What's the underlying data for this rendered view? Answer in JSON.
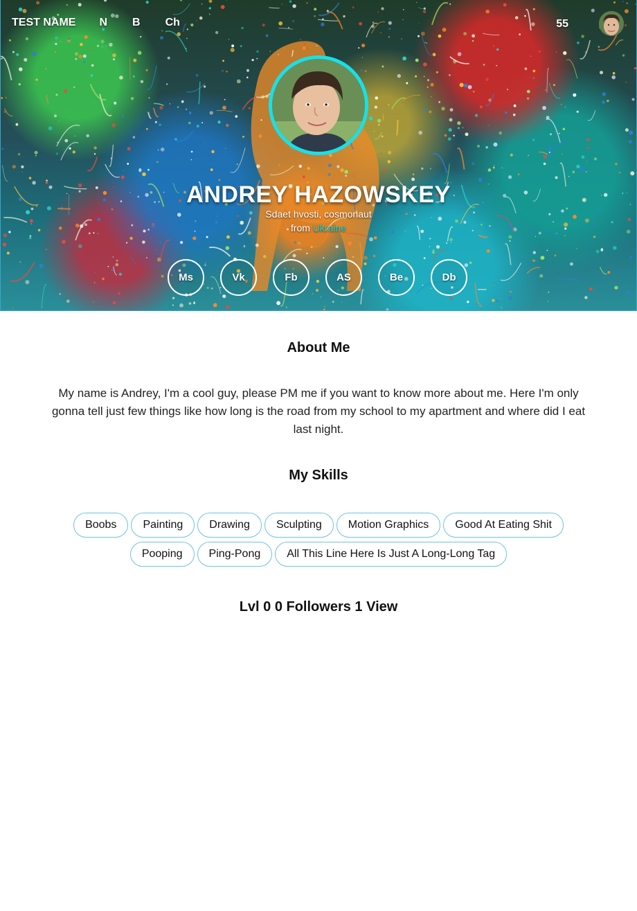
{
  "nav": {
    "brand": "TEST NAME",
    "items": [
      {
        "label": "N"
      },
      {
        "label": "B"
      },
      {
        "label": "Ch"
      }
    ],
    "count": "55"
  },
  "profile": {
    "name": "ANDREY HAZOWSKEY",
    "tagline": "Sdaet hvosti, cosmonaut",
    "from_prefix": "from",
    "country": "Ukraine"
  },
  "socials": [
    {
      "label": "Ms"
    },
    {
      "label": "Vk"
    },
    {
      "label": "Fb"
    },
    {
      "label": "AS"
    },
    {
      "label": "Be"
    },
    {
      "label": "Db"
    }
  ],
  "about": {
    "title": "About Me",
    "text": "My name is Andrey, I'm a cool guy, please PM me if you want to know more about me. Here I'm only gonna tell just few things like how long is the road from my school to my apartment and where did I eat last night."
  },
  "skills": {
    "title": "My Skills",
    "tags": [
      "Boobs",
      "Painting",
      "Drawing",
      "Sculpting",
      "Motion Graphics",
      "Good At Eating Shit",
      "Pooping",
      "Ping-Pong",
      "All This Line Here Is Just A Long-Long Tag"
    ]
  },
  "stats": {
    "text": "Lvl 0 0 Followers 1 View"
  },
  "colors": {
    "accent": "#16e1ea",
    "tag_border": "#6ec3e2",
    "link": "#13d6e0"
  }
}
